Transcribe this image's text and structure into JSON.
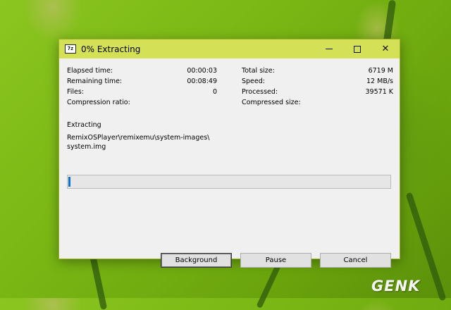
{
  "window": {
    "title": "0% Extracting",
    "app_icon": "7z"
  },
  "stats_left": [
    {
      "label": "Elapsed time:",
      "value": "00:00:03"
    },
    {
      "label": "Remaining time:",
      "value": "00:08:49"
    },
    {
      "label": "Files:",
      "value": "0"
    },
    {
      "label": "Compression ratio:",
      "value": ""
    }
  ],
  "stats_right": [
    {
      "label": "Total size:",
      "value": "6719 M"
    },
    {
      "label": "Speed:",
      "value": "12 MB/s"
    },
    {
      "label": "Processed:",
      "value": "39571 K"
    },
    {
      "label": "Compressed size:",
      "value": ""
    }
  ],
  "status": {
    "action": "Extracting",
    "path_line1": "RemixOSPlayer\\remixemu\\system-images\\",
    "path_line2": "system.img"
  },
  "progress": {
    "percent": 0.6
  },
  "buttons": {
    "background": "Background",
    "pause": "Pause",
    "cancel": "Cancel"
  },
  "watermark": "GENK",
  "colors": {
    "titlebar": "#d4e157",
    "progress_fill": "#0a6fd6"
  }
}
